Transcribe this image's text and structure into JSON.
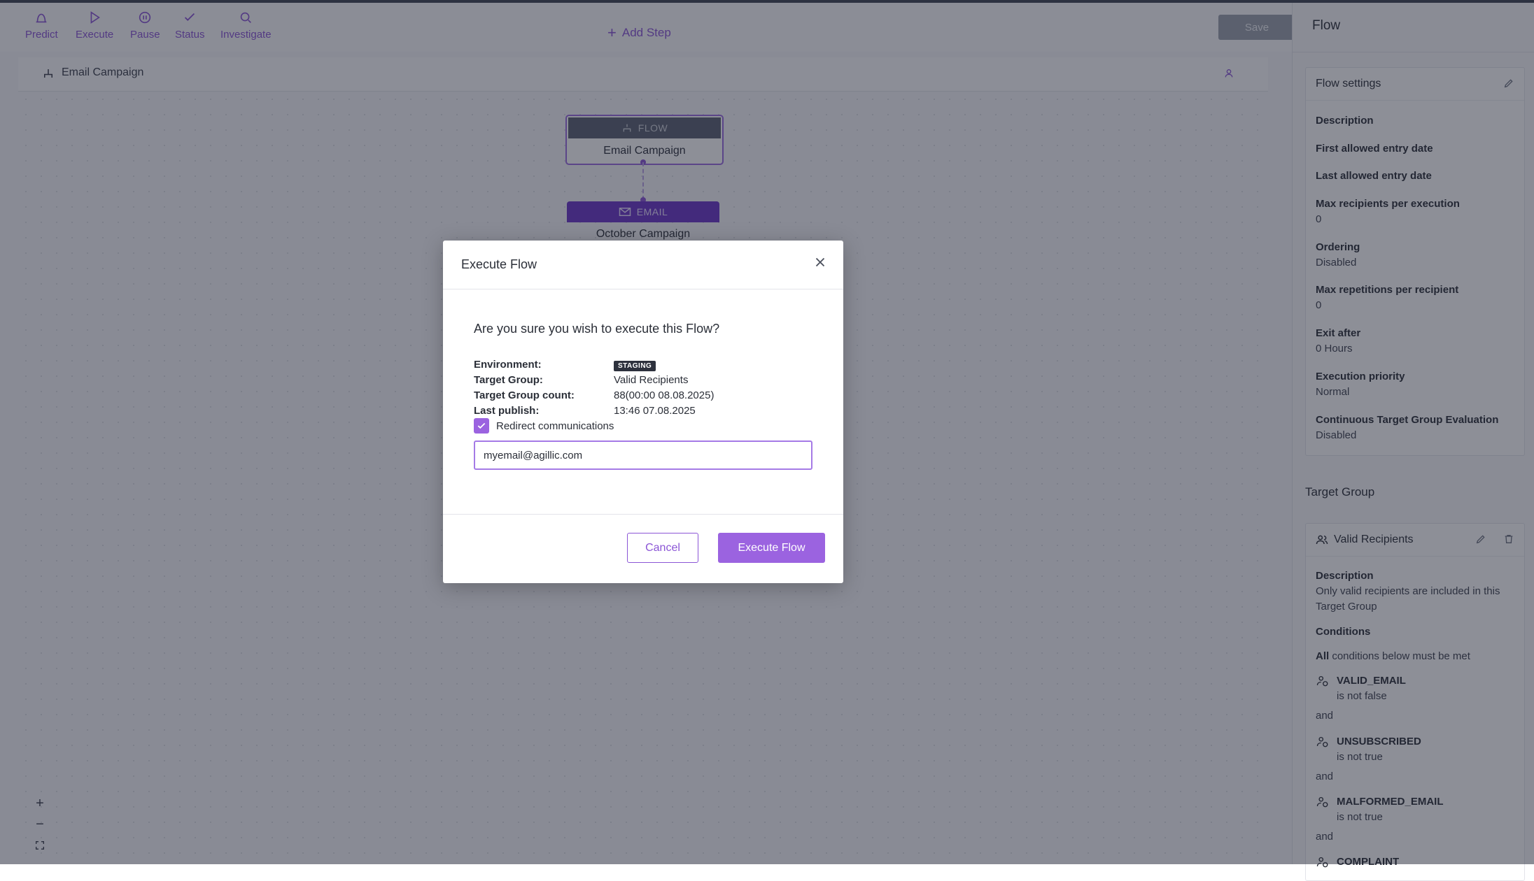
{
  "toolbar": {
    "predict": "Predict",
    "execute": "Execute",
    "pause": "Pause",
    "status": "Status",
    "investigate": "Investigate",
    "add_step": "Add Step",
    "save": "Save"
  },
  "breadcrumb": {
    "title": "Email Campaign"
  },
  "canvas": {
    "flow_node": {
      "type": "FLOW",
      "name": "Email Campaign"
    },
    "email_node": {
      "type": "EMAIL",
      "name": "October Campaign"
    },
    "zoom": {
      "in": "+",
      "out": "−"
    }
  },
  "panel": {
    "title": "Flow",
    "settings": {
      "heading": "Flow settings",
      "description_label": "Description",
      "first_entry_label": "First allowed entry date",
      "last_entry_label": "Last allowed entry date",
      "max_recipients_label": "Max recipients per execution",
      "max_recipients_value": "0",
      "ordering_label": "Ordering",
      "ordering_value": "Disabled",
      "max_repetitions_label": "Max repetitions per recipient",
      "max_repetitions_value": "0",
      "exit_after_label": "Exit after",
      "exit_after_value": "0 Hours",
      "priority_label": "Execution priority",
      "priority_value": "Normal",
      "continuous_label": "Continuous Target Group Evaluation",
      "continuous_value": "Disabled"
    },
    "target_group": {
      "heading": "Target Group",
      "name": "Valid Recipients",
      "description_label": "Description",
      "description_value_1": "Only valid recipients are included in this",
      "description_value_2": "Target Group",
      "conditions_label": "Conditions",
      "conditions_all": "All",
      "conditions_rest": " conditions below must be met",
      "conditions": [
        {
          "name": "VALID_EMAIL",
          "rule": "is not false",
          "joiner": "and"
        },
        {
          "name": "UNSUBSCRIBED",
          "rule": "is not true",
          "joiner": "and"
        },
        {
          "name": "MALFORMED_EMAIL",
          "rule": "is not true",
          "joiner": "and"
        },
        {
          "name": "COMPLAINT"
        }
      ]
    }
  },
  "modal": {
    "title": "Execute Flow",
    "question": "Are you sure you wish to execute this Flow?",
    "environment_label": "Environment:",
    "environment_value": "STAGING",
    "target_group_label": "Target Group:",
    "target_group_value": "Valid Recipients",
    "count_label": "Target Group count:",
    "count_value": "88(00:00 08.08.2025)",
    "last_publish_label": "Last publish:",
    "last_publish_value": "13:46 07.08.2025",
    "redirect_label": "Redirect communications",
    "redirect_checked": true,
    "email_value": "myemail@agillic.com",
    "cancel": "Cancel",
    "execute": "Execute Flow"
  }
}
